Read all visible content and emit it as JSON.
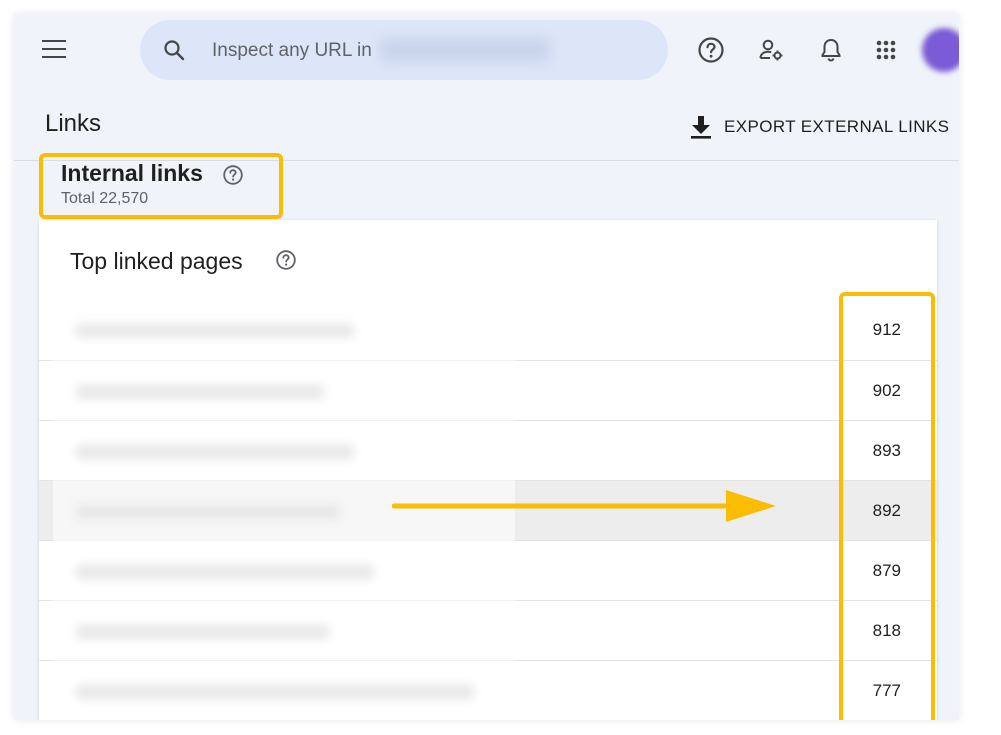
{
  "colors": {
    "accent_highlight": "#fbbc04",
    "background": "#f0f3f9",
    "search_bg": "#dde6f8",
    "text_primary": "#1f1f1f",
    "text_secondary": "#5f6368"
  },
  "topbar": {
    "menu_icon": "hamburger-menu-icon",
    "search": {
      "placeholder": "Inspect any URL in",
      "icon": "search-icon"
    },
    "icons": [
      "help-icon",
      "manage-users-icon",
      "notifications-bell-icon",
      "apps-grid-icon",
      "avatar"
    ]
  },
  "page": {
    "title": "Links",
    "export_label": "EXPORT EXTERNAL LINKS",
    "export_icon": "download-icon"
  },
  "section": {
    "title": "Internal links",
    "total": "Total 22,570",
    "help_icon": "help-circle-icon"
  },
  "card": {
    "title": "Top linked pages",
    "help_icon": "help-circle-icon",
    "rows": [
      {
        "count": "912"
      },
      {
        "count": "902"
      },
      {
        "count": "893"
      },
      {
        "count": "892"
      },
      {
        "count": "879"
      },
      {
        "count": "818"
      },
      {
        "count": "777"
      }
    ]
  }
}
